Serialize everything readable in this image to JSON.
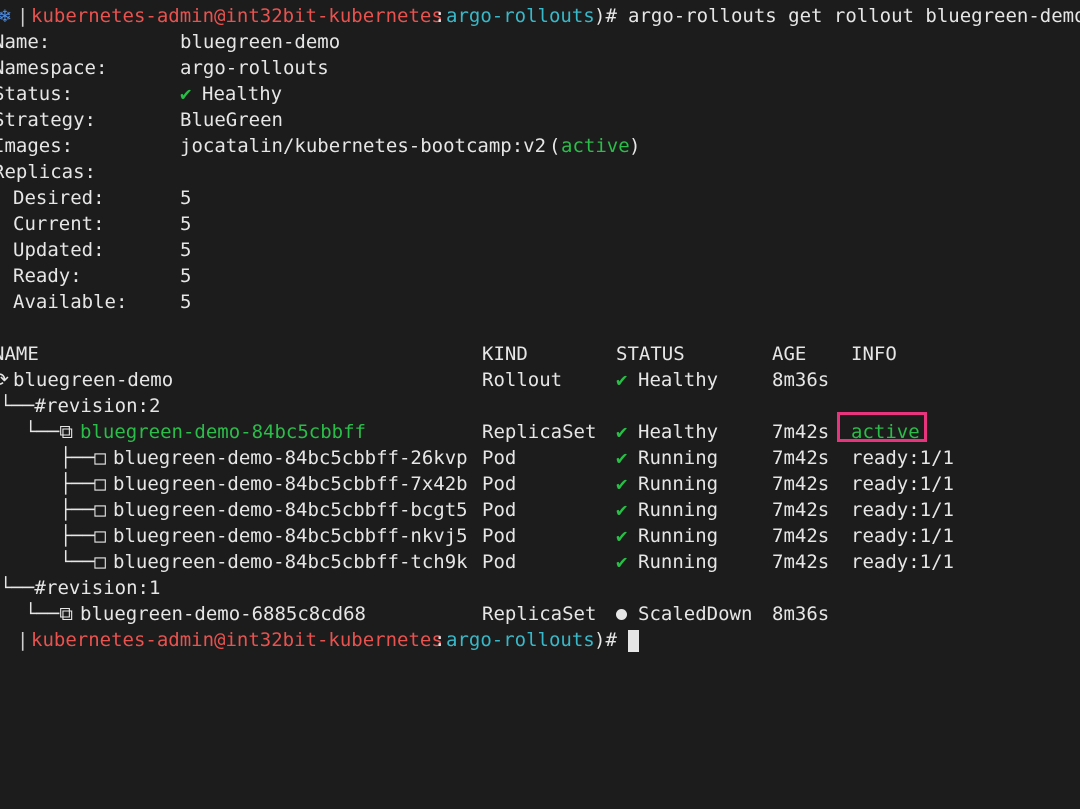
{
  "prompt": {
    "icon": "❄",
    "user": "kubernetes-admin@int32bit-kubernetes",
    "sep": ":",
    "namespace": "argo-rollouts",
    "close": ")# ",
    "command": "argo-rollouts get rollout bluegreen-demo"
  },
  "summary": {
    "name_label": "Name:",
    "name_value": "bluegreen-demo",
    "namespace_label": "Namespace:",
    "namespace_value": "argo-rollouts",
    "status_label": "Status:",
    "status_icon": "✔",
    "status_value": "Healthy",
    "strategy_label": "Strategy:",
    "strategy_value": "BlueGreen",
    "images_label": "Images:",
    "images_value": "jocatalin/kubernetes-bootcamp:v2",
    "images_tag": "active",
    "replicas_label": "Replicas:",
    "replicas": [
      {
        "label": "Desired:",
        "value": "5"
      },
      {
        "label": "Current:",
        "value": "5"
      },
      {
        "label": "Updated:",
        "value": "5"
      },
      {
        "label": "Ready:",
        "value": "5"
      },
      {
        "label": "Available:",
        "value": "5"
      }
    ]
  },
  "table": {
    "headers": {
      "name": "NAME",
      "kind": "KIND",
      "status": "STATUS",
      "age": "AGE",
      "info": "INFO"
    },
    "rollout": {
      "prefix": "⟳",
      "name": "bluegreen-demo",
      "kind": "Rollout",
      "status_icon": "✔",
      "status": "Healthy",
      "age": "8m36s"
    },
    "revision2": {
      "prefix": "└──# ",
      "label": "revision:2"
    },
    "rs_active": {
      "prefix": "└──⧉ ",
      "name": "bluegreen-demo-84bc5cbbff",
      "kind": "ReplicaSet",
      "status_icon": "✔",
      "status": "Healthy",
      "age": "7m42s",
      "info": "active"
    },
    "pods": [
      {
        "prefix": "├──□ ",
        "name": "bluegreen-demo-84bc5cbbff-26kvp",
        "kind": "Pod",
        "status_icon": "✔",
        "status": "Running",
        "age": "7m42s",
        "info": "ready:1/1"
      },
      {
        "prefix": "├──□ ",
        "name": "bluegreen-demo-84bc5cbbff-7x42b",
        "kind": "Pod",
        "status_icon": "✔",
        "status": "Running",
        "age": "7m42s",
        "info": "ready:1/1"
      },
      {
        "prefix": "├──□ ",
        "name": "bluegreen-demo-84bc5cbbff-bcgt5",
        "kind": "Pod",
        "status_icon": "✔",
        "status": "Running",
        "age": "7m42s",
        "info": "ready:1/1"
      },
      {
        "prefix": "├──□ ",
        "name": "bluegreen-demo-84bc5cbbff-nkvj5",
        "kind": "Pod",
        "status_icon": "✔",
        "status": "Running",
        "age": "7m42s",
        "info": "ready:1/1"
      },
      {
        "prefix": "└──□ ",
        "name": "bluegreen-demo-84bc5cbbff-tch9k",
        "kind": "Pod",
        "status_icon": "✔",
        "status": "Running",
        "age": "7m42s",
        "info": "ready:1/1"
      }
    ],
    "revision1": {
      "prefix": "└──# ",
      "label": "revision:1"
    },
    "rs_old": {
      "prefix": "└──⧉ ",
      "name": "bluegreen-demo-6885c8cd68",
      "kind": "ReplicaSet",
      "status": "ScaledDown",
      "age": "8m36s"
    }
  },
  "prompt2": {
    "user": "kubernetes-admin@int32bit-kubernetes",
    "sep": ":",
    "namespace": "argo-rollouts",
    "close": ")# "
  },
  "colors": {
    "background": "#1c1c1c",
    "prompt_user": "#e8524f",
    "prompt_namespace": "#37b9c9",
    "healthy": "#2bbd4a",
    "highlight_box": "#e8347c"
  }
}
